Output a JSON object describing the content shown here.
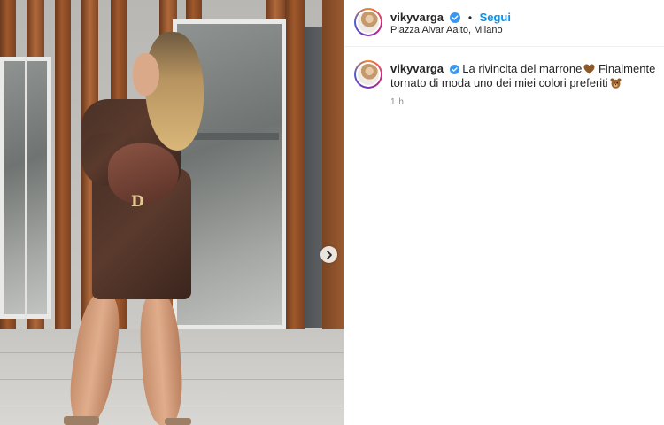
{
  "post": {
    "username": "vikyvarga",
    "verified": true,
    "follow_label": "Segui",
    "dot": "•",
    "location": "Piazza Alvar Aalto, Milano"
  },
  "caption": {
    "username": "vikyvarga",
    "text_part1": "La rivincita del marrone",
    "emoji1": "brown-heart",
    "text_part2": " Finalmente tornato di moda uno dei miei colori preferiti",
    "emoji2": "bear",
    "time": "1 h"
  },
  "colors": {
    "link_blue": "#0095f6",
    "verified_blue": "#3897f0",
    "muted": "#8e8e8e"
  },
  "photo": {
    "bag_letter": "D"
  }
}
